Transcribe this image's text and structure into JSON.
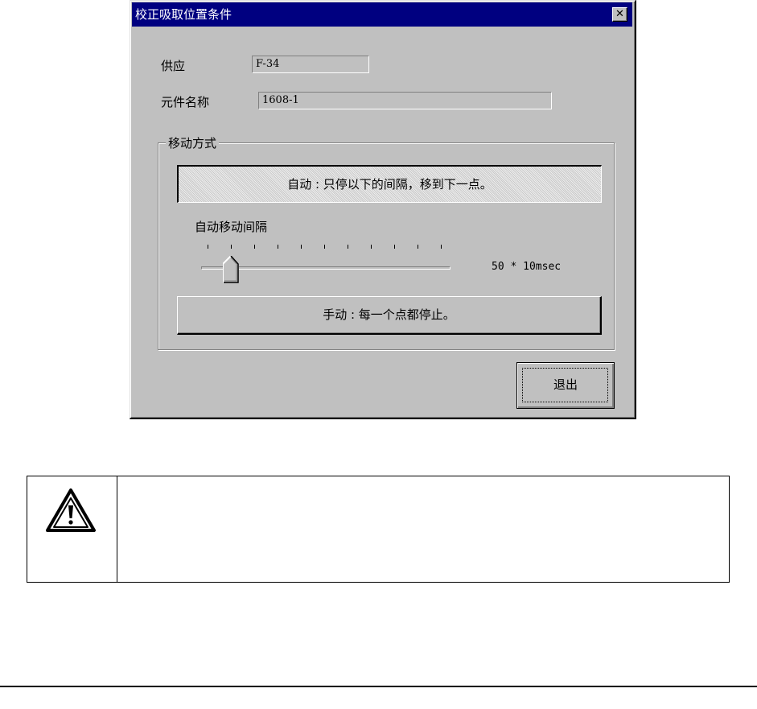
{
  "dialog": {
    "title": "校正吸取位置条件",
    "close_label": "✕",
    "supply_label": "供应",
    "supply_value": "F-34",
    "part_name_label": "元件名称",
    "part_name_value": "1608-1",
    "move_mode": {
      "legend": "移动方式",
      "auto_button": "自动 : 只停以下的间隔，移到下一点。",
      "slider_label": "自动移动间隔",
      "slider_value": "50 * 10msec",
      "slider_position_fraction": 0.1,
      "manual_button": "手动 : 每一个点都停止。"
    },
    "exit_button": "退出"
  },
  "warning": {
    "icon": "warning-triangle-icon",
    "text": ""
  },
  "colors": {
    "titlebar": "#000080",
    "dialog_bg": "#c0c0c0"
  }
}
